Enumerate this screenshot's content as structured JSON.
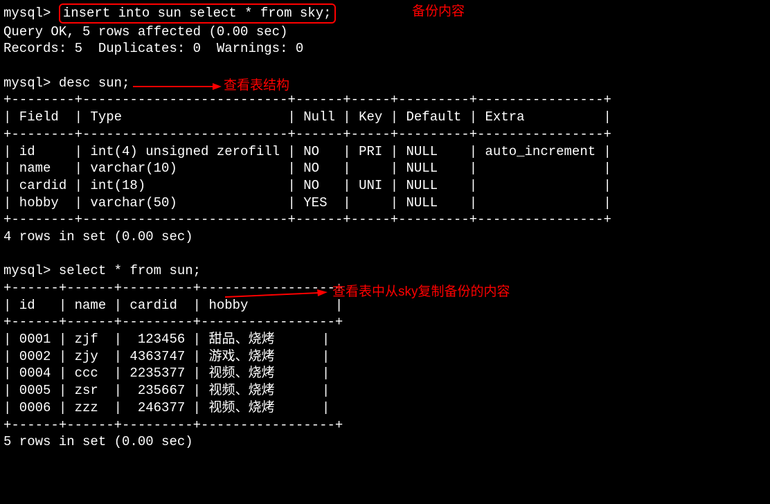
{
  "prompt": "mysql>",
  "commands": {
    "insert": "insert into sun select * from sky;",
    "desc": "desc sun;",
    "select": "select * from sun;"
  },
  "results": {
    "query_ok": "Query OK, 5 rows affected (0.00 sec)",
    "records_line": "Records: 5  Duplicates: 0  Warnings: 0",
    "desc_footer": "4 rows in set (0.00 sec)",
    "select_footer": "5 rows in set (0.00 sec)"
  },
  "annotations": {
    "backup": "备份内容",
    "view_structure": "查看表结构",
    "view_copied": "查看表中从sky复制备份的内容"
  },
  "desc_table": {
    "border_top": "+--------+--------------------------+------+-----+---------+----------------+",
    "header": "| Field  | Type                     | Null | Key | Default | Extra          |",
    "rows": [
      "| id     | int(4) unsigned zerofill | NO   | PRI | NULL    | auto_increment |",
      "| name   | varchar(10)              | NO   |     | NULL    |                |",
      "| cardid | int(18)                  | NO   | UNI | NULL    |                |",
      "| hobby  | varchar(50)              | YES  |     | NULL    |                |"
    ]
  },
  "select_table": {
    "border_top": "+------+------+---------+-----------------+",
    "header": "| id   | name | cardid  | hobby           |",
    "rows": [
      "| 0001 | zjf  |  123456 | 甜品、烧烤      |",
      "| 0002 | zjy  | 4363747 | 游戏、烧烤      |",
      "| 0004 | ccc  | 2235377 | 视频、烧烤      |",
      "| 0005 | zsr  |  235667 | 视频、烧烤      |",
      "| 0006 | zzz  |  246377 | 视频、烧烤      |"
    ]
  },
  "chart_data": {
    "type": "table",
    "tables": [
      {
        "name": "desc sun",
        "columns": [
          "Field",
          "Type",
          "Null",
          "Key",
          "Default",
          "Extra"
        ],
        "rows": [
          [
            "id",
            "int(4) unsigned zerofill",
            "NO",
            "PRI",
            "NULL",
            "auto_increment"
          ],
          [
            "name",
            "varchar(10)",
            "NO",
            "",
            "NULL",
            ""
          ],
          [
            "cardid",
            "int(18)",
            "NO",
            "UNI",
            "NULL",
            ""
          ],
          [
            "hobby",
            "varchar(50)",
            "YES",
            "",
            "NULL",
            ""
          ]
        ]
      },
      {
        "name": "select * from sun",
        "columns": [
          "id",
          "name",
          "cardid",
          "hobby"
        ],
        "rows": [
          [
            "0001",
            "zjf",
            "123456",
            "甜品、烧烤"
          ],
          [
            "0002",
            "zjy",
            "4363747",
            "游戏、烧烤"
          ],
          [
            "0004",
            "ccc",
            "2235377",
            "视频、烧烤"
          ],
          [
            "0005",
            "zsr",
            "235667",
            "视频、烧烤"
          ],
          [
            "0006",
            "zzz",
            "246377",
            "视频、烧烤"
          ]
        ]
      }
    ]
  }
}
